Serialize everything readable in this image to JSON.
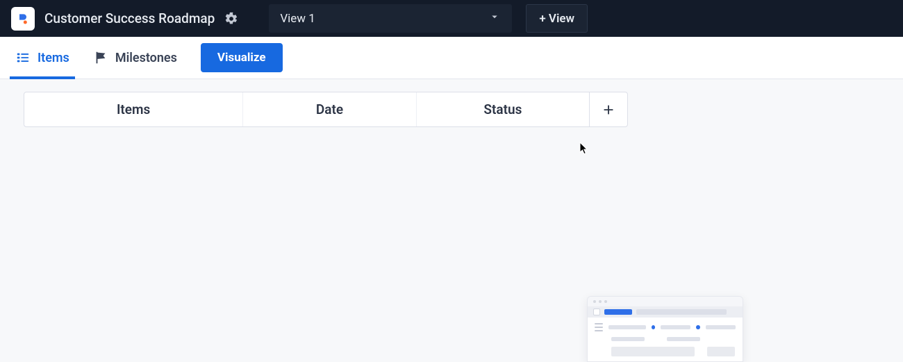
{
  "header": {
    "title": "Customer Success Roadmap",
    "view_selected": "View 1",
    "add_view_label": "+ View"
  },
  "tabs": {
    "items_label": "Items",
    "milestones_label": "Milestones",
    "visualize_label": "Visualize"
  },
  "columns": {
    "items": "Items",
    "date": "Date",
    "status": "Status"
  }
}
